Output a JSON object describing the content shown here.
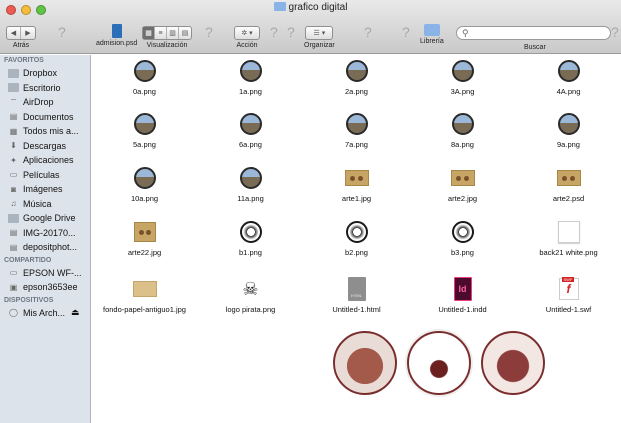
{
  "window": {
    "title": "grafico digital",
    "light_colors": [
      "#ee5b53",
      "#f5bd3b",
      "#5fc544"
    ]
  },
  "toolbar": {
    "back_label": "Atrás",
    "current_file_label": "admision.psd",
    "view_label": "Visualización",
    "action_label": "Acción",
    "arrange_label": "Organizar",
    "library_label": "Librería",
    "search_label": "Buscar",
    "search_placeholder": ""
  },
  "sidebar": {
    "favorites_header": "FAVORITOS",
    "favorites": [
      {
        "label": "Dropbox",
        "icon": "folder-icon"
      },
      {
        "label": "Escritorio",
        "icon": "folder-icon"
      },
      {
        "label": "AirDrop",
        "icon": "airdrop-icon"
      },
      {
        "label": "Documentos",
        "icon": "document-icon"
      },
      {
        "label": "Todos mis a...",
        "icon": "all-files-icon"
      },
      {
        "label": "Descargas",
        "icon": "download-icon"
      },
      {
        "label": "Aplicaciones",
        "icon": "applications-icon"
      },
      {
        "label": "Películas",
        "icon": "movies-icon"
      },
      {
        "label": "Imágenes",
        "icon": "camera-icon"
      },
      {
        "label": "Música",
        "icon": "music-icon"
      },
      {
        "label": "Google Drive",
        "icon": "folder-icon"
      },
      {
        "label": "IMG-20170...",
        "icon": "document-icon"
      },
      {
        "label": "depositphot...",
        "icon": "document-icon"
      }
    ],
    "shared_header": "COMPARTIDO",
    "shared": [
      {
        "label": "EPSON WF-...",
        "icon": "printer-icon"
      },
      {
        "label": "epson3653ee",
        "icon": "server-icon"
      }
    ],
    "devices_header": "DISPOSITIVOS",
    "devices": [
      {
        "label": "Mis Arch...",
        "icon": "disk-icon",
        "eject": "⏏"
      }
    ]
  },
  "files": [
    {
      "name": "0a.png",
      "kind": "circle-photo"
    },
    {
      "name": "1a.png",
      "kind": "circle-photo"
    },
    {
      "name": "2a.png",
      "kind": "circle-photo"
    },
    {
      "name": "3A.png",
      "kind": "circle-photo"
    },
    {
      "name": "4A.png",
      "kind": "circle-photo"
    },
    {
      "name": "5a.png",
      "kind": "circle-photo"
    },
    {
      "name": "6a.png",
      "kind": "circle-photo"
    },
    {
      "name": "7a.png",
      "kind": "circle-photo"
    },
    {
      "name": "8a.png",
      "kind": "circle-photo"
    },
    {
      "name": "9a.png",
      "kind": "circle-photo"
    },
    {
      "name": "10a.png",
      "kind": "circle-photo"
    },
    {
      "name": "11a.png",
      "kind": "circle-photo"
    },
    {
      "name": "arte1.jpg",
      "kind": "brown-art"
    },
    {
      "name": "arte2.jpg",
      "kind": "brown-art"
    },
    {
      "name": "arte2.psd",
      "kind": "brown-art"
    },
    {
      "name": "arte22.jpg",
      "kind": "brown-square"
    },
    {
      "name": "b1.png",
      "kind": "circle-bw"
    },
    {
      "name": "b2.png",
      "kind": "circle-bw"
    },
    {
      "name": "b3.png",
      "kind": "circle-bw"
    },
    {
      "name": "back21 white.png",
      "kind": "white-square"
    },
    {
      "name": "fondo-papel-antiguo1.jpg",
      "kind": "paper"
    },
    {
      "name": "logo pirata.png",
      "kind": "pirate"
    },
    {
      "name": "Untitled-1.html",
      "kind": "html-doc"
    },
    {
      "name": "Untitled-1.indd",
      "kind": "indd-doc"
    },
    {
      "name": "Untitled-1.swf",
      "kind": "swf-doc"
    }
  ],
  "file_badges": {
    "html_badge": "HTML",
    "indd_badge": "Id",
    "swf_badge": "SWF",
    "swf_letter": "f"
  },
  "colors": {
    "sidebar_bg": "#dde3ea",
    "seal_brown": "#7a2d2d"
  }
}
